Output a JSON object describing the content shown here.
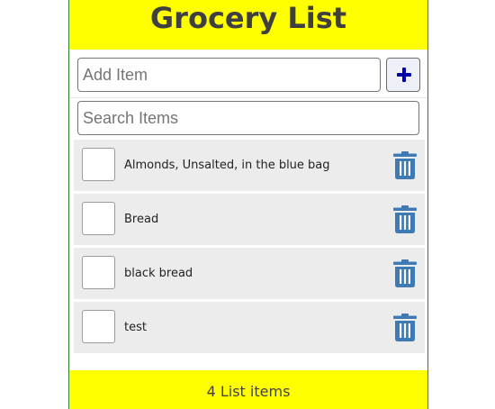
{
  "header": {
    "title": "Grocery List"
  },
  "add_item": {
    "placeholder": "Add Item",
    "value": "",
    "button_icon": "plus-icon"
  },
  "search": {
    "placeholder": "Search Items",
    "value": ""
  },
  "items": [
    {
      "label": "Almonds, Unsalted, in the blue bag",
      "checked": false,
      "delete_icon": "trash-icon"
    },
    {
      "label": "Bread",
      "checked": false,
      "delete_icon": "trash-icon"
    },
    {
      "label": "black bread",
      "checked": false,
      "delete_icon": "trash-icon"
    },
    {
      "label": "test",
      "checked": false,
      "delete_icon": "trash-icon"
    }
  ],
  "footer": {
    "count_text": "4 List items"
  },
  "colors": {
    "header_bg": "#ffff00",
    "footer_bg": "#ffff00",
    "title_text": "#3f3f3f",
    "add_icon": "#0000aa",
    "trash_icon": "#3f7ab5",
    "item_bg": "#ececec"
  }
}
